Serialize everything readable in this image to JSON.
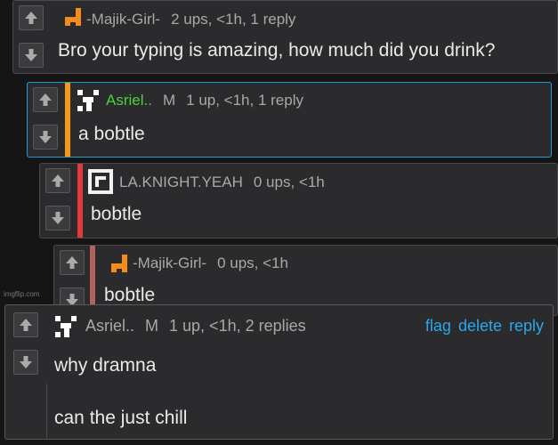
{
  "comments": [
    {
      "username": "-Majik-Girl-",
      "stats": "2 ups, <1h, 1 reply",
      "body": "Bro your typing is amazing, how much did you drink?"
    },
    {
      "username": "Asriel..",
      "badge": "M",
      "stats": "1 up, <1h, 1 reply",
      "body": "a bobtle",
      "bar_color": "#f29a17",
      "username_color": "#4cd23c"
    },
    {
      "username": "LA.KNIGHT.YEAH",
      "stats": "0 ups, <1h",
      "body": "bobtle",
      "bar_color": "#e23a3a"
    },
    {
      "username": "-Majik-Girl-",
      "stats": "0 ups, <1h",
      "body": "bobtle",
      "bar_color": "#b2625d"
    },
    {
      "username": "Asriel..",
      "badge": "M",
      "stats": "1 up, <1h, 2 replies",
      "body_lines": [
        "why dramna",
        "can the just chill"
      ],
      "actions": [
        "flag",
        "delete",
        "reply"
      ]
    }
  ],
  "watermark": "imgflip.com",
  "icons": {
    "upvote": "arrow-up-icon",
    "downvote": "arrow-down-icon",
    "avatar_majik": "orange-pixel-avatar",
    "avatar_asriel": "white-pixel-avatar",
    "avatar_la": "white-square-avatar"
  },
  "colors": {
    "link": "#2aa8e8",
    "panel": "#2b2b2d",
    "background": "#151515"
  }
}
